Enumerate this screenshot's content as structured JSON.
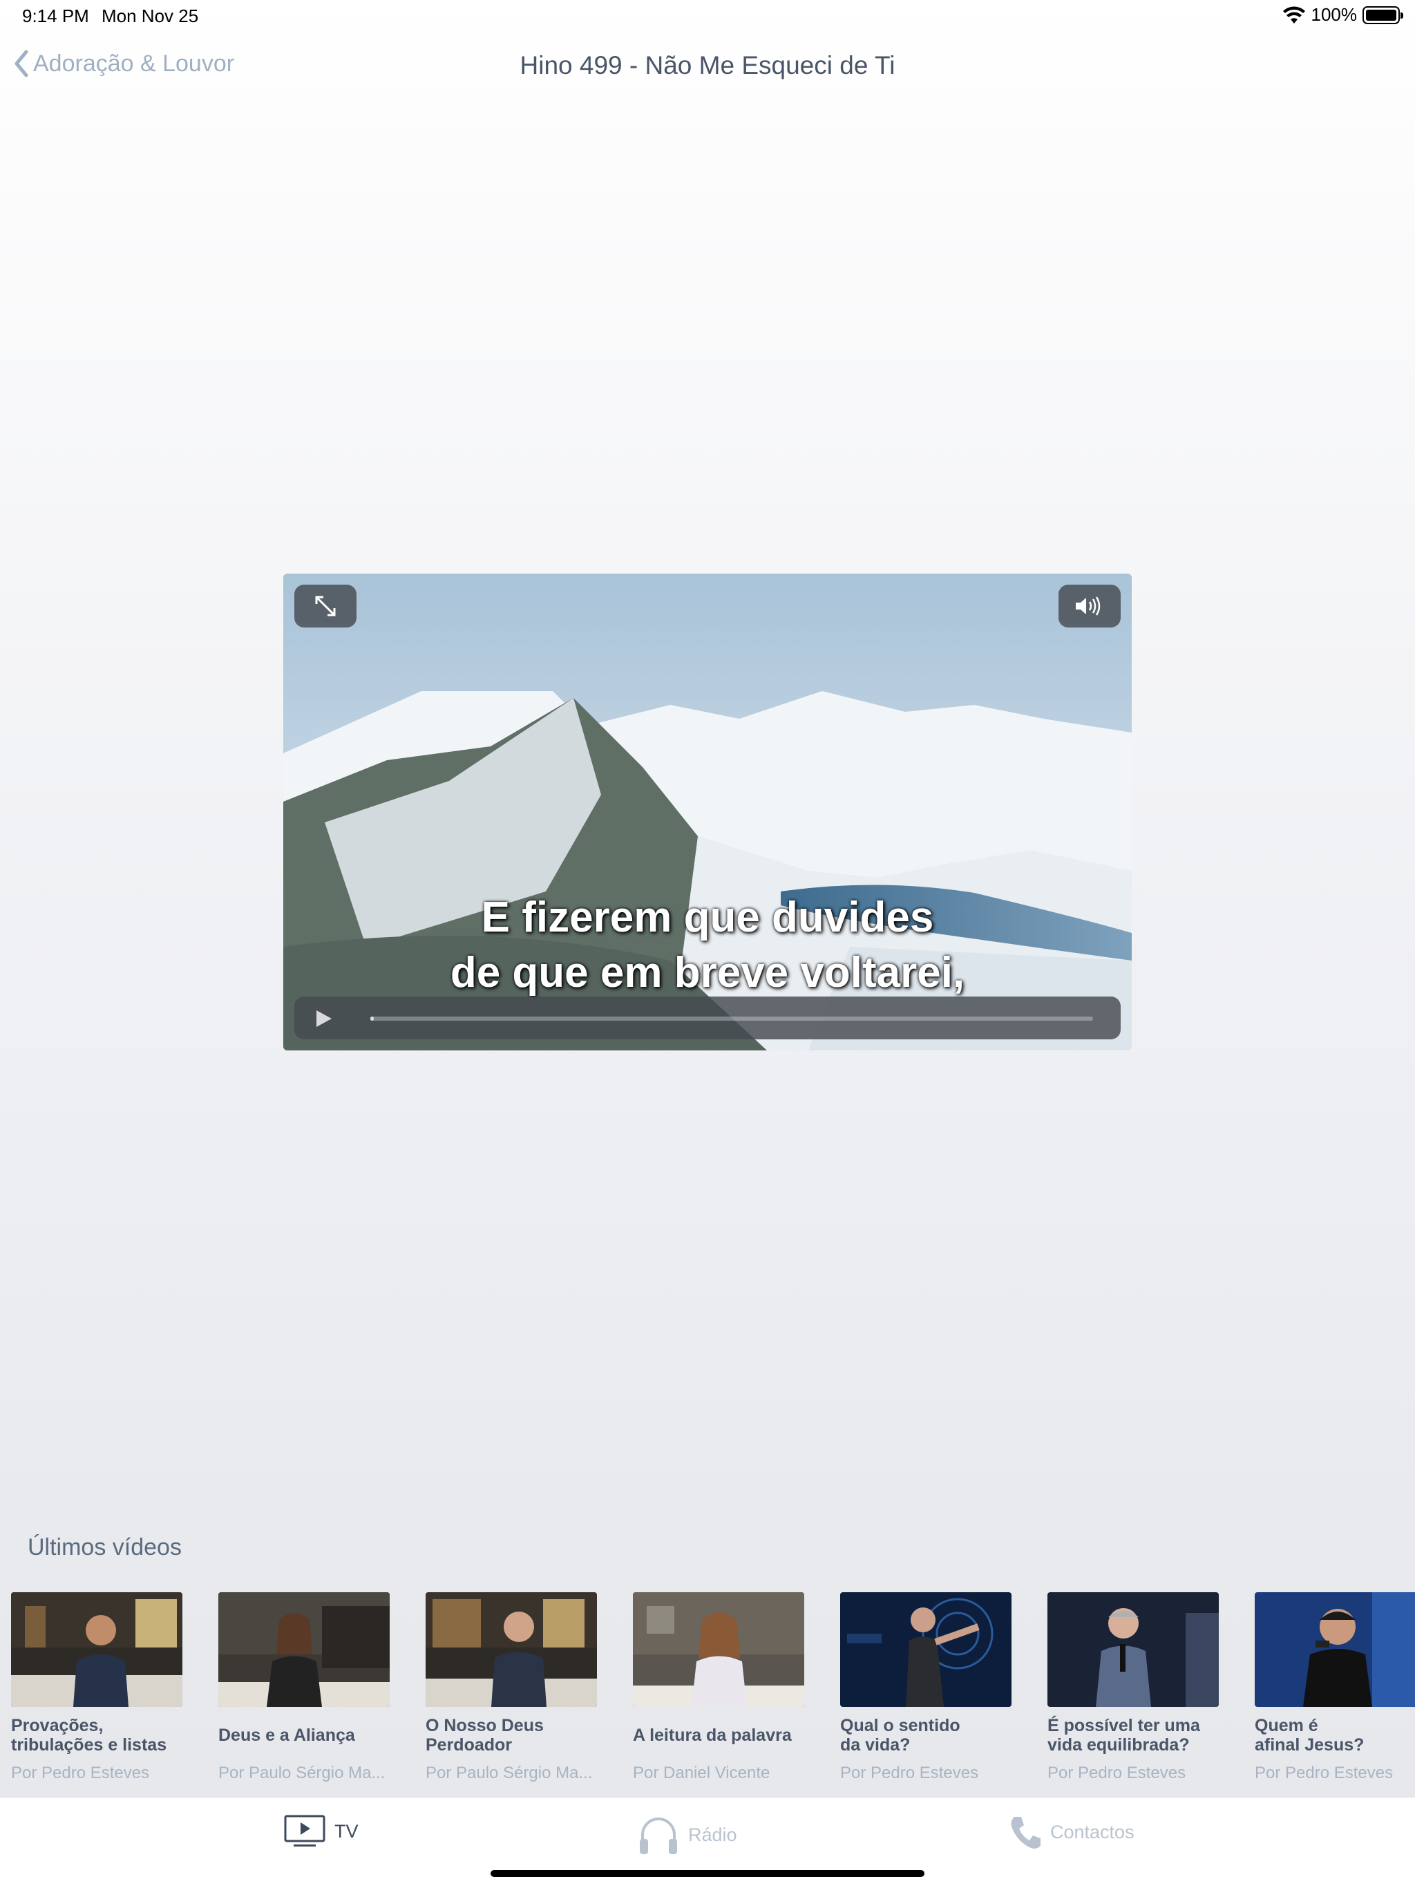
{
  "status_bar": {
    "time": "9:14 PM",
    "date": "Mon Nov 25",
    "battery": "100%"
  },
  "nav": {
    "back_label": "Adoração & Louvor",
    "title": "Hino 499 - Não Me Esqueci de Ti"
  },
  "player": {
    "caption_line1": "E fizerem que duvides",
    "caption_line2": "de que em breve voltarei,",
    "progress": 0.005
  },
  "latest": {
    "title": "Últimos vídeos",
    "items": [
      {
        "title": "Provações,\ntribulações e listas",
        "author": "Por Pedro Esteves"
      },
      {
        "title": "Deus e a Aliança",
        "author": "Por Paulo Sérgio Ma..."
      },
      {
        "title": "O Nosso Deus\nPerdoador",
        "author": "Por Paulo Sérgio Ma..."
      },
      {
        "title": "A leitura da palavra",
        "author": "Por Daniel Vicente"
      },
      {
        "title": "Qual o sentido\nda vida?",
        "author": "Por Pedro Esteves"
      },
      {
        "title": "É possível ter uma\nvida equilibrada?",
        "author": "Por Pedro Esteves"
      },
      {
        "title": "Quem é\nafinal Jesus?",
        "author": "Por Pedro Esteves"
      }
    ]
  },
  "tabs": {
    "tv": "TV",
    "radio": "Rádio",
    "contacts": "Contactos"
  },
  "colors": {
    "accent": "#3d4a5c",
    "inactive": "#b9c3cf",
    "link": "#9fb0c3"
  }
}
